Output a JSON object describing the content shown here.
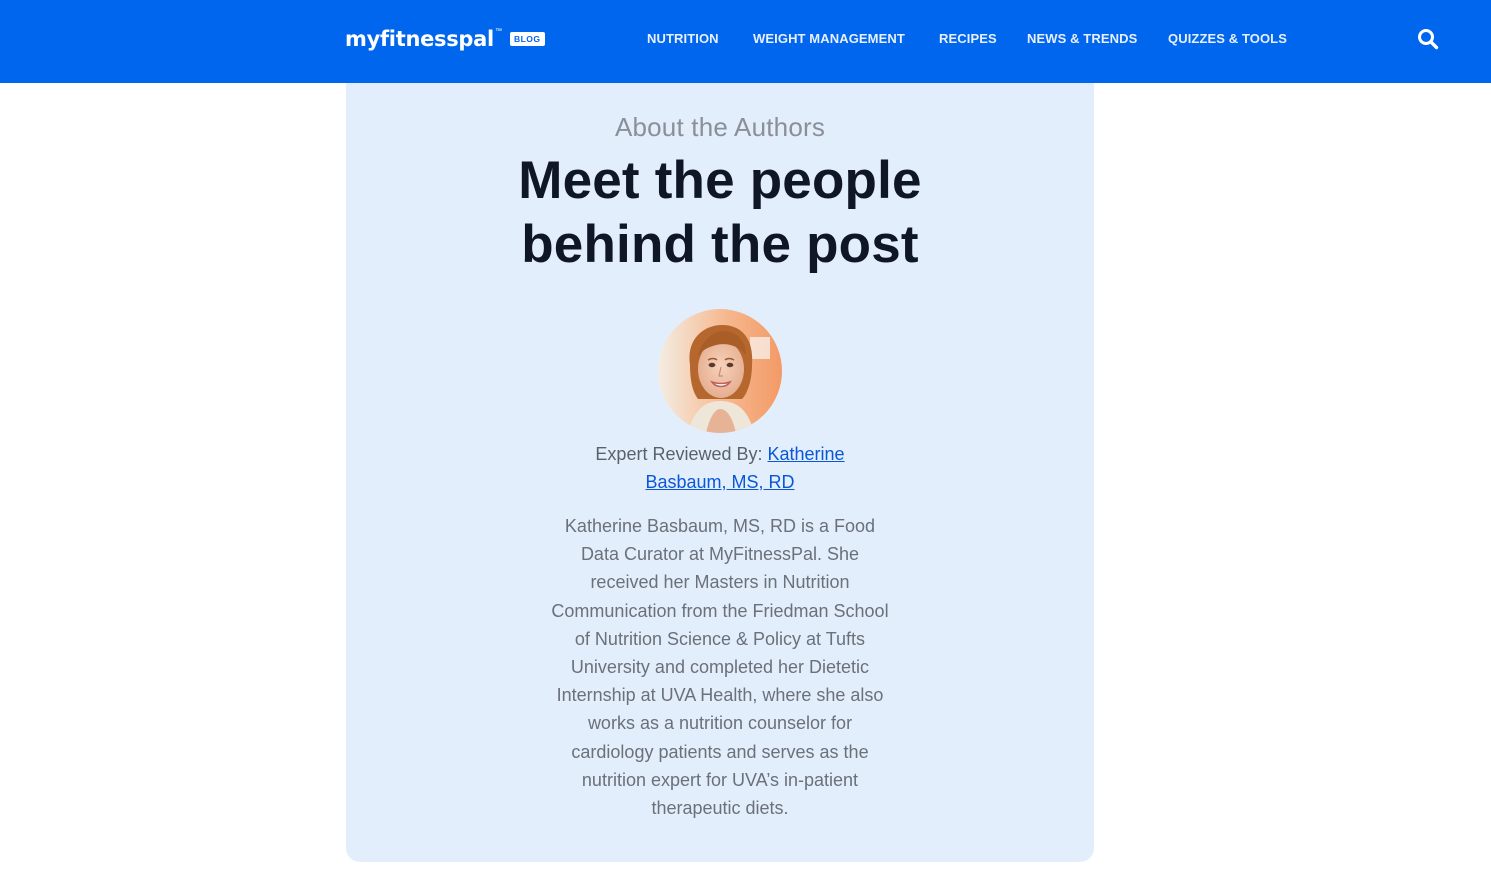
{
  "header": {
    "logo_text": "myfitnesspal",
    "logo_tm": "™",
    "logo_badge": "BLOG",
    "nav": [
      {
        "label": "NUTRITION"
      },
      {
        "label": "WEIGHT MANAGEMENT"
      },
      {
        "label": "RECIPES"
      },
      {
        "label": "NEWS & TRENDS"
      },
      {
        "label": "QUIZZES & TOOLS"
      }
    ],
    "search_icon": "search-icon",
    "colors": {
      "bar": "#0066ee",
      "text": "#ffffff"
    }
  },
  "authors": {
    "eyebrow": "About the Authors",
    "headline": "Meet the people behind the post",
    "reviewer_prefix": "Expert Reviewed By:",
    "reviewer_name": "Katherine Basbaum, MS, RD",
    "bio": "Katherine Basbaum, MS, RD is a Food Data Curator at MyFitnessPal. She received her Masters in Nutrition Communication from the Friedman School of Nutrition Science & Policy at Tufts University and completed her Dietetic Internship at UVA Health, where she also works as a nutrition counselor for cardiology patients and serves as the nutrition expert for UVA’s in-patient therapeutic diets.",
    "colors": {
      "card": "#e3eefd",
      "link": "#0a57d6",
      "headline": "#0f1626"
    }
  }
}
